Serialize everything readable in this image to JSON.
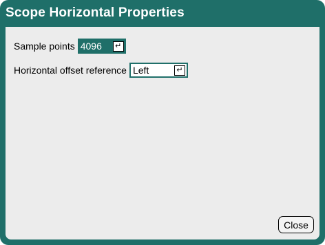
{
  "dialog": {
    "title": "Scope Horizontal Properties",
    "accent_color": "#1f6f69",
    "panel_color": "#ececec"
  },
  "sample_points": {
    "label": "Sample points",
    "value": "4096",
    "enter_icon": "enter-return-icon"
  },
  "horizontal_offset": {
    "label": "Horizontal offset reference",
    "value": "Left",
    "enter_icon": "enter-return-icon"
  },
  "footer": {
    "close_label": "Close"
  }
}
